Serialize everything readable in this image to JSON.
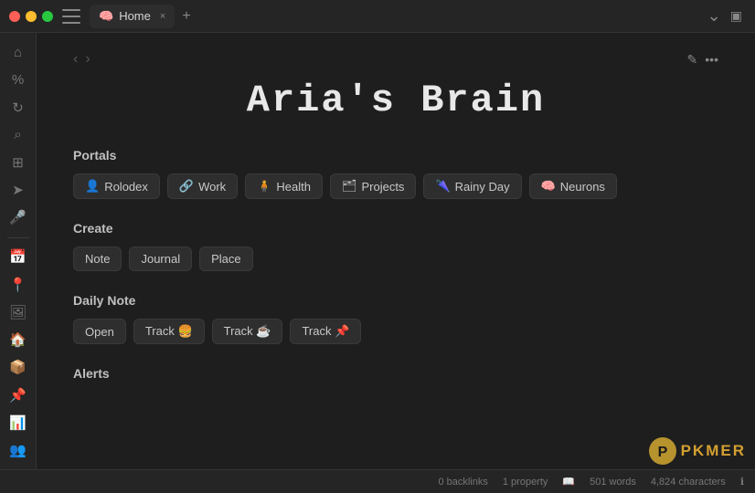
{
  "window": {
    "title": "Home"
  },
  "titleBar": {
    "tabIcon": "🧠",
    "tabTitle": "Home",
    "closeLabel": "×",
    "addLabel": "+",
    "navBack": "‹",
    "navForward": "›",
    "editIcon": "✎",
    "moreIcon": "•••"
  },
  "sidebar": {
    "icons": [
      {
        "name": "home-icon",
        "glyph": "⌂"
      },
      {
        "name": "percent-icon",
        "glyph": "%"
      },
      {
        "name": "refresh-icon",
        "glyph": "↻"
      },
      {
        "name": "search-icon",
        "glyph": "⌕"
      },
      {
        "name": "grid-icon",
        "glyph": "⊞"
      },
      {
        "name": "send-icon",
        "glyph": "➤"
      },
      {
        "name": "mic-icon",
        "glyph": "🎤"
      },
      {
        "name": "calendar-icon",
        "glyph": "📅"
      },
      {
        "name": "location-icon",
        "glyph": "📍"
      },
      {
        "name": "image-icon",
        "glyph": "🖼"
      },
      {
        "name": "shop-icon",
        "glyph": "🏠"
      },
      {
        "name": "box-icon",
        "glyph": "📦"
      },
      {
        "name": "pin-icon",
        "glyph": "📌"
      },
      {
        "name": "chart-icon",
        "glyph": "📊"
      },
      {
        "name": "people-icon",
        "glyph": "👥"
      }
    ]
  },
  "page": {
    "title": "Aria's Brain"
  },
  "portals": {
    "heading": "Portals",
    "items": [
      {
        "label": "Rolodex",
        "emoji": "👤"
      },
      {
        "label": "Work",
        "emoji": "🔗"
      },
      {
        "label": "Health",
        "emoji": "🧍"
      },
      {
        "label": "Projects",
        "emoji": "🗂"
      },
      {
        "label": "Rainy Day",
        "emoji": "🌂"
      },
      {
        "label": "Neurons",
        "emoji": "🧠"
      }
    ]
  },
  "create": {
    "heading": "Create",
    "items": [
      {
        "label": "Note",
        "emoji": ""
      },
      {
        "label": "Journal",
        "emoji": ""
      },
      {
        "label": "Place",
        "emoji": ""
      }
    ]
  },
  "dailyNote": {
    "heading": "Daily Note",
    "items": [
      {
        "label": "Open",
        "emoji": ""
      },
      {
        "label": "Track 🍔",
        "emoji": ""
      },
      {
        "label": "Track ☕",
        "emoji": ""
      },
      {
        "label": "Track 📌",
        "emoji": ""
      }
    ]
  },
  "alerts": {
    "heading": "Alerts"
  },
  "bottomBar": {
    "backlinks": "0 backlinks",
    "property": "1 property",
    "words": "501 words",
    "characters": "4,824 characters",
    "pkmerText": "PKMER"
  }
}
